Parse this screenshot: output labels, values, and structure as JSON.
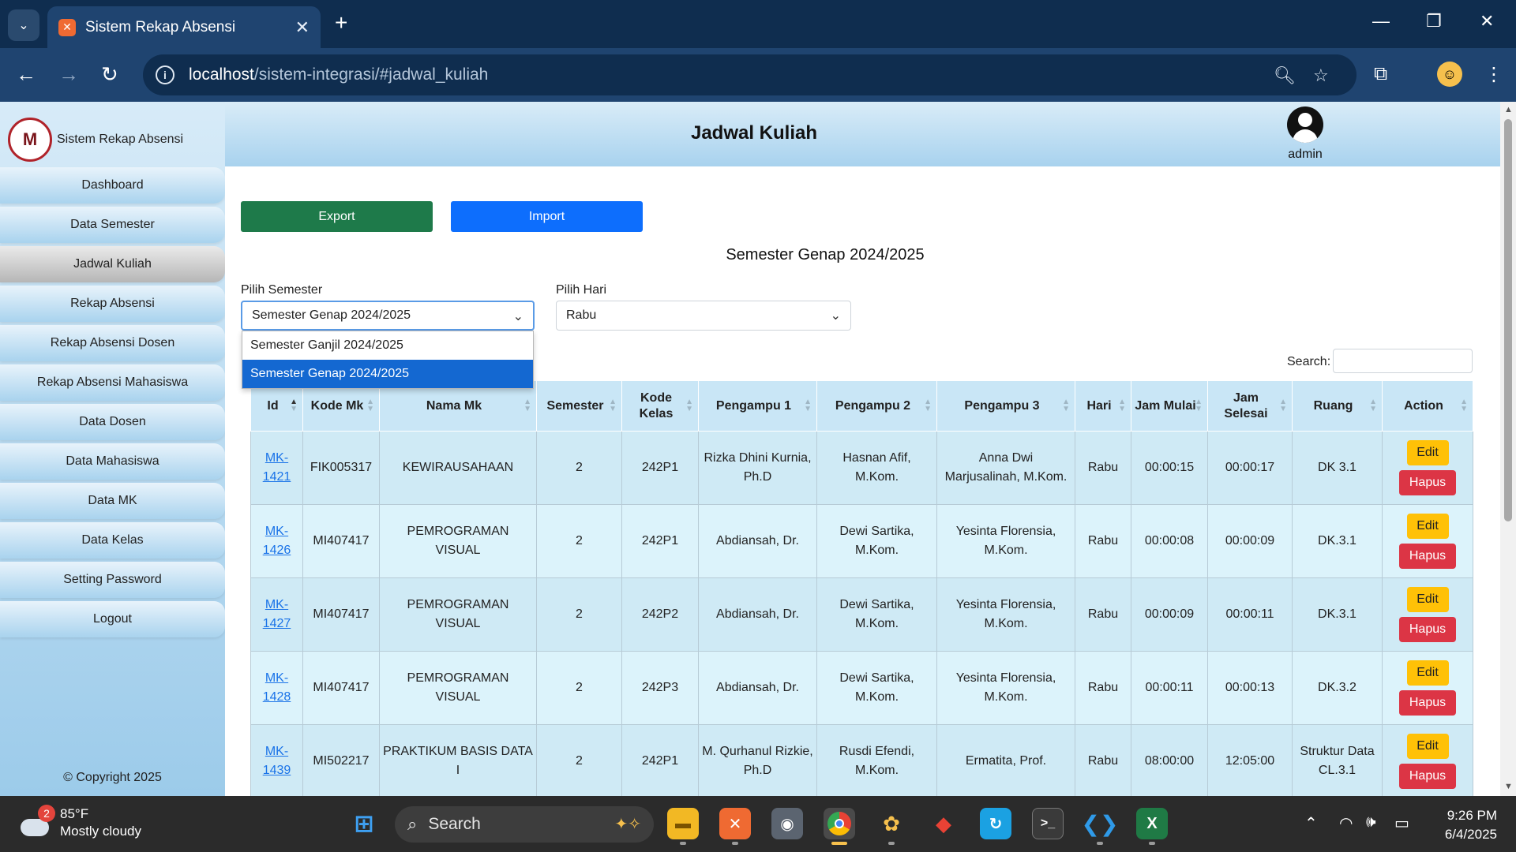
{
  "browser": {
    "tab_title": "Sistem Rekap Absensi",
    "url_host": "localhost",
    "url_path": "/sistem-integrasi/#jadwal_kuliah"
  },
  "sidebar": {
    "brand_name": "Sistem Rekap Absensi",
    "logo_text": "M",
    "items": [
      {
        "label": "Dashboard",
        "active": false
      },
      {
        "label": "Data Semester",
        "active": false
      },
      {
        "label": "Jadwal Kuliah",
        "active": true
      },
      {
        "label": "Rekap Absensi",
        "active": false
      },
      {
        "label": "Rekap Absensi Dosen",
        "active": false
      },
      {
        "label": "Rekap Absensi Mahasiswa",
        "active": false
      },
      {
        "label": "Data Dosen",
        "active": false
      },
      {
        "label": "Data Mahasiswa",
        "active": false
      },
      {
        "label": "Data MK",
        "active": false
      },
      {
        "label": "Data Kelas",
        "active": false
      },
      {
        "label": "Setting Password",
        "active": false
      },
      {
        "label": "Logout",
        "active": false
      }
    ],
    "copyright": "© Copyright 2025"
  },
  "header": {
    "title": "Jadwal Kuliah",
    "user_name": "admin"
  },
  "actions": {
    "export_label": "Export",
    "import_label": "Import"
  },
  "semester_heading": "Semester Genap 2024/2025",
  "filters": {
    "semester_label": "Pilih Semester",
    "semester_value": "Semester Genap 2024/2025",
    "semester_options": [
      "Semester Ganjil 2024/2025",
      "Semester Genap 2024/2025"
    ],
    "semester_selected_index": 1,
    "hari_label": "Pilih Hari",
    "hari_value": "Rabu"
  },
  "search": {
    "label": "Search:",
    "value": ""
  },
  "table": {
    "columns": [
      {
        "label": "Id",
        "sorted": "asc"
      },
      {
        "label": "Kode Mk"
      },
      {
        "label": "Nama Mk"
      },
      {
        "label": "Semester"
      },
      {
        "label": "Kode Kelas"
      },
      {
        "label": "Pengampu 1"
      },
      {
        "label": "Pengampu 2"
      },
      {
        "label": "Pengampu 3"
      },
      {
        "label": "Hari"
      },
      {
        "label": "Jam Mulai"
      },
      {
        "label": "Jam Selesai"
      },
      {
        "label": "Ruang"
      },
      {
        "label": "Action"
      }
    ],
    "edit_label": "Edit",
    "delete_label": "Hapus",
    "rows": [
      {
        "id": "MK-1421",
        "kode_mk": "FIK005317",
        "nama_mk": "KEWIRAUSAHAAN",
        "semester": "2",
        "kode_kelas": "242P1",
        "pengampu1": "Rizka Dhini Kurnia, Ph.D",
        "pengampu2": "Hasnan Afif, M.Kom.",
        "pengampu3": "Anna Dwi Marjusalinah, M.Kom.",
        "hari": "Rabu",
        "jam_mulai": "00:00:15",
        "jam_selesai": "00:00:17",
        "ruang": "DK 3.1"
      },
      {
        "id": "MK-1426",
        "kode_mk": "MI407417",
        "nama_mk": "PEMROGRAMAN VISUAL",
        "semester": "2",
        "kode_kelas": "242P1",
        "pengampu1": "Abdiansah, Dr.",
        "pengampu2": "Dewi Sartika, M.Kom.",
        "pengampu3": "Yesinta Florensia, M.Kom.",
        "hari": "Rabu",
        "jam_mulai": "00:00:08",
        "jam_selesai": "00:00:09",
        "ruang": "DK.3.1"
      },
      {
        "id": "MK-1427",
        "kode_mk": "MI407417",
        "nama_mk": "PEMROGRAMAN VISUAL",
        "semester": "2",
        "kode_kelas": "242P2",
        "pengampu1": "Abdiansah, Dr.",
        "pengampu2": "Dewi Sartika, M.Kom.",
        "pengampu3": "Yesinta Florensia, M.Kom.",
        "hari": "Rabu",
        "jam_mulai": "00:00:09",
        "jam_selesai": "00:00:11",
        "ruang": "DK.3.1"
      },
      {
        "id": "MK-1428",
        "kode_mk": "MI407417",
        "nama_mk": "PEMROGRAMAN VISUAL",
        "semester": "2",
        "kode_kelas": "242P3",
        "pengampu1": "Abdiansah, Dr.",
        "pengampu2": "Dewi Sartika, M.Kom.",
        "pengampu3": "Yesinta Florensia, M.Kom.",
        "hari": "Rabu",
        "jam_mulai": "00:00:11",
        "jam_selesai": "00:00:13",
        "ruang": "DK.3.2"
      },
      {
        "id": "MK-1439",
        "kode_mk": "MI502217",
        "nama_mk": "PRAKTIKUM BASIS DATA I",
        "semester": "2",
        "kode_kelas": "242P1",
        "pengampu1": "M. Qurhanul Rizkie, Ph.D",
        "pengampu2": "Rusdi Efendi, M.Kom.",
        "pengampu3": "Ermatita, Prof.",
        "hari": "Rabu",
        "jam_mulai": "08:00:00",
        "jam_selesai": "12:05:00",
        "ruang": "Struktur Data CL.3.1"
      }
    ]
  },
  "taskbar": {
    "weather_temp": "85°F",
    "weather_desc": "Mostly cloudy",
    "weather_badge": "2",
    "search_label": "Search",
    "time": "9:26 PM",
    "date": "6/4/2025"
  },
  "colors": {
    "export": "#1e7a4a",
    "import": "#0d6efd",
    "edit": "#ffc107",
    "delete": "#dc3545",
    "link": "#1a73e8"
  }
}
